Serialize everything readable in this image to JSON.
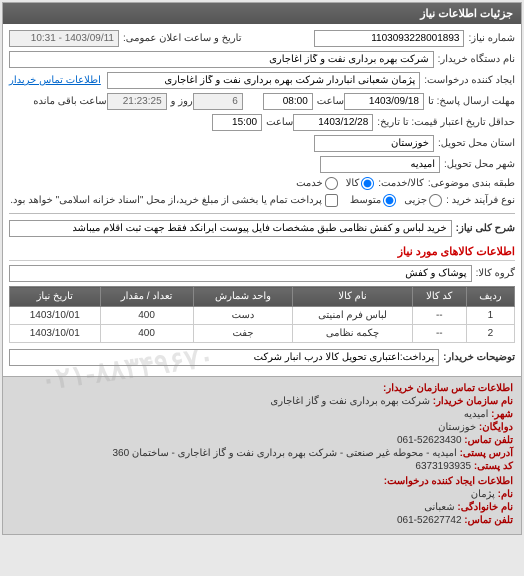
{
  "panel_title": "جزئیات اطلاعات نیاز",
  "labels": {
    "request_no": "شماره نیاز:",
    "announce_datetime": "تاریخ و ساعت اعلان عمومی:",
    "buyer_org": "نام دستگاه خریدار:",
    "requester": "ایجاد کننده درخواست:",
    "contact_link": "اطلاعات تماس خریدار",
    "deadline_from": "مهلت ارسال پاسخ: تا",
    "time": "ساعت",
    "days_and": "روز و",
    "remaining": "ساعت باقی مانده",
    "validity_from": "حداقل تاریخ اعتبار قیمت: تا تاریخ:",
    "delivery_province": "استان محل تحویل:",
    "delivery_city": "شهر محل تحویل:",
    "packaging": "طبقه بندی موضوعی:",
    "item_service": "کالا/خدمت:",
    "goods": "کالا",
    "service": "خدمت",
    "process_type": "نوع فرآیند خرید :",
    "partial": "جزیی",
    "medium": "متوسط",
    "payment_note": "پرداخت تمام یا بخشی از مبلغ خرید،از محل \"اسناد خزانه اسلامی\" خواهد بود.",
    "general_title": "شرح کلی نیاز:",
    "items_info": "اطلاعات کالاهای مورد نیاز",
    "item_group": "گروه کالا:",
    "buyer_notes": "توضیحات خریدار:"
  },
  "values": {
    "request_no": "1103093228001893",
    "announce_datetime": "1403/09/11 - 10:31",
    "buyer_org": "شرکت بهره برداری نفت و گاز اغاجاری",
    "requester": "پژمان شعبانی انباردار شرکت بهره برداری نفت و گاز اغاجاری",
    "deadline_date": "1403/09/18",
    "deadline_time": "08:00",
    "days_left": "6",
    "time_left": "21:23:25",
    "validity_date": "1403/12/28",
    "validity_time": "15:00",
    "province": "خوزستان",
    "city": "امیدیه",
    "general_desc": "خرید لباس و کفش نظامی طبق مشخصات فایل پیوست ایرانکد فقط جهت ثبت اقلام میباشد",
    "item_group": "پوشاک و کفش",
    "buyer_notes": "پرداخت:اعتباری تحویل کالا درب انبار شرکت"
  },
  "table": {
    "headers": {
      "row": "ردیف",
      "code": "کد کالا",
      "name": "نام کالا",
      "unit": "واحد شمارش",
      "qty": "تعداد / مقدار",
      "date": "تاریخ نیاز"
    },
    "rows": [
      {
        "row": "1",
        "code": "--",
        "name": "لباس فرم امنیتی",
        "unit": "دست",
        "qty": "400",
        "date": "1403/10/01"
      },
      {
        "row": "2",
        "code": "--",
        "name": "چکمه نظامی",
        "unit": "جفت",
        "qty": "400",
        "date": "1403/10/01"
      }
    ]
  },
  "footer": {
    "title": "اطلاعات تماس سازمان خریدار:",
    "org_lbl": "نام سازمان خریدار:",
    "org_val": "شرکت بهره برداری نفت و گاز اغاجاری",
    "city_lbl": "شهر:",
    "city_val": "امیدیه",
    "province_lbl": "دوایگان:",
    "province_val": "خوزستان",
    "phone_lbl": "تلفن تماس:",
    "phone_val": "52623430-061",
    "postal_lbl": "آدرس پستی:",
    "postal_val": "امیدیه - محوطه غیر صنعتی - شرکت بهره برداری نفت و گاز اغاجاری - ساختمان 360",
    "postcode_lbl": "کد پستی:",
    "postcode_val": "6373193935",
    "creator_title": "اطلاعات ایجاد کننده درخواست:",
    "fname_lbl": "نام:",
    "fname_val": "پژمان",
    "lname_lbl": "نام خانوادگی:",
    "lname_val": "شعبانی",
    "cphone_lbl": "تلفن تماس:",
    "cphone_val": "52627742-061"
  },
  "watermark": "۰۲۱-۸۸۳۴۹۶۷۰"
}
